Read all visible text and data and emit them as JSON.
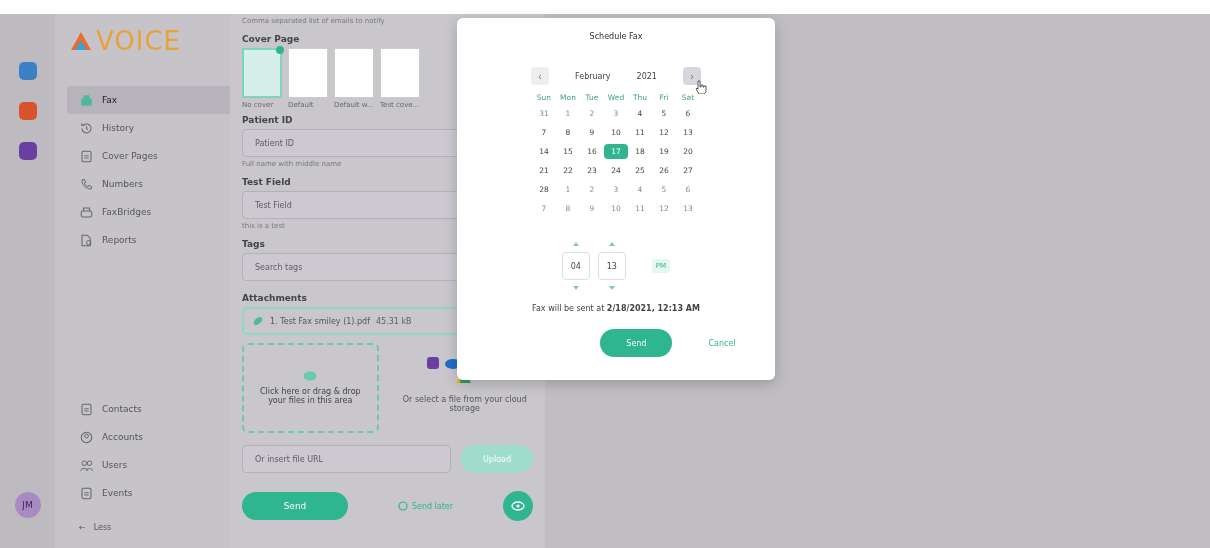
{
  "rail": {
    "apps": [
      {
        "color": "#3b7fc4"
      },
      {
        "color": "#d9532c"
      },
      {
        "color": "#6b3fa0"
      }
    ],
    "avatar": "JM"
  },
  "sidebar": {
    "logo": "VOICE",
    "items": [
      {
        "label": "Fax",
        "kind": "fax",
        "selected": true
      },
      {
        "label": "History",
        "kind": "history",
        "selected": false
      },
      {
        "label": "Cover Pages",
        "kind": "doc",
        "selected": false
      },
      {
        "label": "Numbers",
        "kind": "phone",
        "selected": false
      },
      {
        "label": "FaxBridges",
        "kind": "printer",
        "selected": false
      },
      {
        "label": "Reports",
        "kind": "report",
        "selected": false
      }
    ],
    "bottom_items": [
      {
        "label": "Contacts",
        "kind": "doc",
        "selected": false
      },
      {
        "label": "Accounts",
        "kind": "user",
        "selected": false
      },
      {
        "label": "Users",
        "kind": "users",
        "selected": false
      },
      {
        "label": "Events",
        "kind": "doc",
        "selected": false
      }
    ],
    "less": {
      "arrow": "←",
      "label": "Less"
    }
  },
  "form": {
    "notify_hint": "Comma separated list of emails to notify",
    "cover_page": {
      "label": "Cover Page",
      "options": [
        {
          "name": "No cover",
          "selected": true
        },
        {
          "name": "Default",
          "selected": false
        },
        {
          "name": "Default w...",
          "selected": false
        },
        {
          "name": "Test cove...",
          "selected": false
        }
      ]
    },
    "fields": [
      {
        "label": "Patient ID",
        "placeholder": "Patient ID",
        "hint": "Full name with middle name"
      },
      {
        "label": "Test Field",
        "placeholder": "Test Field",
        "hint": "this is a test"
      },
      {
        "label": "Tags",
        "placeholder": "Search tags"
      }
    ],
    "attachments": {
      "label": "Attachments",
      "file": "1. Test Fax smiley (1).pdf",
      "size": "45.31 kB",
      "dropzone": "Click here or drag & drop your files in this area",
      "cloud": "Or select a file from your cloud storage",
      "url_placeholder": "Or insert file URL",
      "upload": "Upload"
    },
    "send": "Send",
    "send_later": "Send later"
  },
  "modal": {
    "title": "Schedule Fax",
    "prev": "‹",
    "month": "February",
    "year": "2021",
    "next": "›",
    "weekdays": [
      "Sun",
      "Mon",
      "Tue",
      "Wed",
      "Thu",
      "Fri",
      "Sat"
    ],
    "weeks": [
      [
        {
          "d": "31",
          "muted": true,
          "selected": false
        },
        {
          "d": "1",
          "muted": true,
          "selected": false
        },
        {
          "d": "2",
          "muted": true,
          "selected": false
        },
        {
          "d": "3",
          "muted": true,
          "selected": false
        },
        {
          "d": "4",
          "muted": false,
          "selected": false
        },
        {
          "d": "5",
          "muted": false,
          "selected": false
        },
        {
          "d": "6",
          "muted": false,
          "selected": false
        }
      ],
      [
        {
          "d": "7",
          "muted": false,
          "selected": false
        },
        {
          "d": "8",
          "muted": false,
          "selected": false
        },
        {
          "d": "9",
          "muted": false,
          "selected": false
        },
        {
          "d": "10",
          "muted": false,
          "selected": false
        },
        {
          "d": "11",
          "muted": false,
          "selected": false
        },
        {
          "d": "12",
          "muted": false,
          "selected": false
        },
        {
          "d": "13",
          "muted": false,
          "selected": false
        }
      ],
      [
        {
          "d": "14",
          "muted": false,
          "selected": false
        },
        {
          "d": "15",
          "muted": false,
          "selected": false
        },
        {
          "d": "16",
          "muted": false,
          "selected": false
        },
        {
          "d": "17",
          "muted": false,
          "selected": true
        },
        {
          "d": "18",
          "muted": false,
          "selected": false
        },
        {
          "d": "19",
          "muted": false,
          "selected": false
        },
        {
          "d": "20",
          "muted": false,
          "selected": false
        }
      ],
      [
        {
          "d": "21",
          "muted": false,
          "selected": false
        },
        {
          "d": "22",
          "muted": false,
          "selected": false
        },
        {
          "d": "23",
          "muted": false,
          "selected": false
        },
        {
          "d": "24",
          "muted": false,
          "selected": false
        },
        {
          "d": "25",
          "muted": false,
          "selected": false
        },
        {
          "d": "26",
          "muted": false,
          "selected": false
        },
        {
          "d": "27",
          "muted": false,
          "selected": false
        }
      ],
      [
        {
          "d": "28",
          "muted": false,
          "selected": false
        },
        {
          "d": "1",
          "muted": true,
          "selected": false
        },
        {
          "d": "2",
          "muted": true,
          "selected": false
        },
        {
          "d": "3",
          "muted": true,
          "selected": false
        },
        {
          "d": "4",
          "muted": true,
          "selected": false
        },
        {
          "d": "5",
          "muted": true,
          "selected": false
        },
        {
          "d": "6",
          "muted": true,
          "selected": false
        }
      ],
      [
        {
          "d": "7",
          "muted": true,
          "selected": false
        },
        {
          "d": "8",
          "muted": true,
          "selected": false
        },
        {
          "d": "9",
          "muted": true,
          "selected": false
        },
        {
          "d": "10",
          "muted": true,
          "selected": false
        },
        {
          "d": "11",
          "muted": true,
          "selected": false
        },
        {
          "d": "12",
          "muted": true,
          "selected": false
        },
        {
          "d": "13",
          "muted": true,
          "selected": false
        }
      ]
    ],
    "hour": "04",
    "minute": "13",
    "period": "PM",
    "summary": "Fax will be sent at **2/18/2021, 12:13 AM**",
    "send": "Send",
    "cancel": "Cancel"
  }
}
